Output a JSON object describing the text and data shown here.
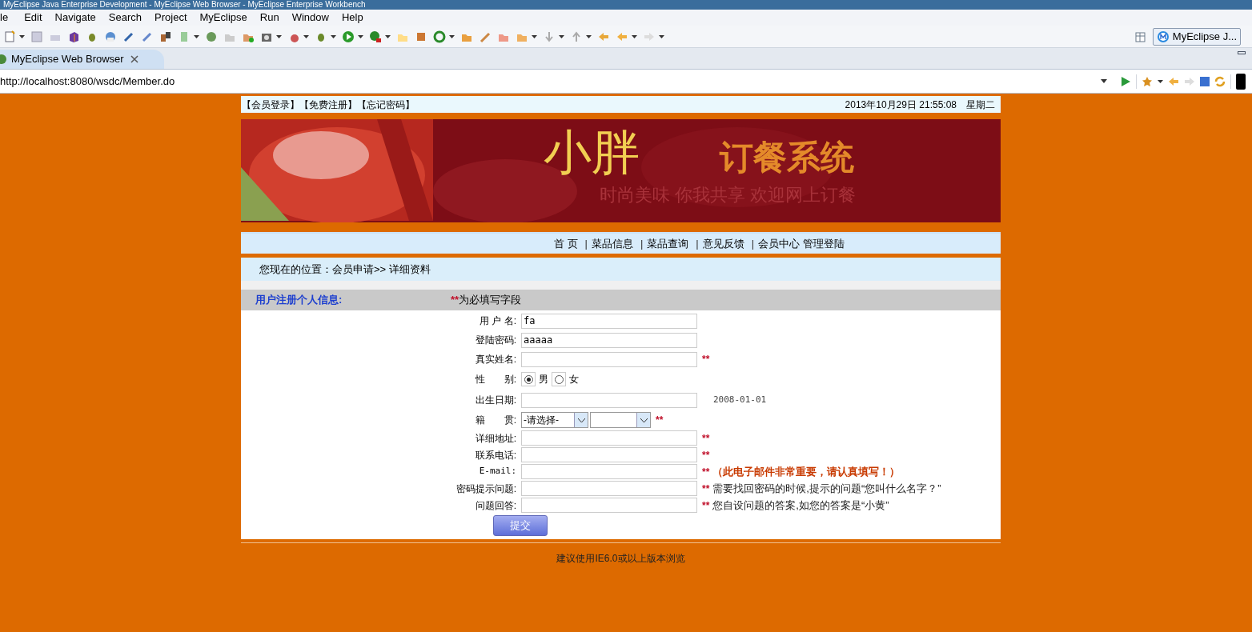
{
  "window": {
    "title": "MyEclipse Java Enterprise Development - MyEclipse Web Browser - MyEclipse Enterprise Workbench"
  },
  "menu": [
    "le",
    "Edit",
    "Navigate",
    "Search",
    "Project",
    "MyEclipse",
    "Run",
    "Window",
    "Help"
  ],
  "perspective": {
    "label": "MyEclipse J..."
  },
  "editor_tab": {
    "label": "MyEclipse Web Browser",
    "selected": true
  },
  "address_bar": {
    "value": "http://localhost:8080/wsdc/Member.do"
  },
  "page": {
    "top_links": [
      "【会员登录】",
      "【免费注册】",
      "【忘记密码】"
    ],
    "datetime": "2013年10月29日 21:55:08",
    "weekday": "星期二",
    "banner": {
      "title": "小胖",
      "subtitle": "订餐系统",
      "slogan": "时尚美味 你我共享 欢迎网上订餐"
    },
    "nav": [
      {
        "kind": "link",
        "label": "首 页"
      },
      {
        "kind": "separator",
        "label": "|"
      },
      {
        "kind": "link",
        "label": "菜品信息"
      },
      {
        "kind": "separator",
        "label": "|"
      },
      {
        "kind": "link",
        "label": "菜品查询"
      },
      {
        "kind": "separator",
        "label": "|"
      },
      {
        "kind": "link",
        "label": "意见反馈"
      },
      {
        "kind": "separator",
        "label": "|"
      },
      {
        "kind": "link",
        "label": "会员中心"
      },
      {
        "kind": "link",
        "label": "管理登陆"
      }
    ],
    "breadcrumb": "您现在的位置：会员申请>> 详细资料",
    "form": {
      "title": "用户注册个人信息:",
      "required_mark": "**",
      "required_note": "为必填写字段",
      "fields": [
        {
          "kind": "text",
          "label": "用 户 名:",
          "value": "fa"
        },
        {
          "kind": "text",
          "label": "登陆密码:",
          "value": "aaaaa"
        },
        {
          "kind": "text",
          "label": "真实姓名:",
          "mark": "**"
        },
        {
          "kind": "radio",
          "label": "性　　别:",
          "options": [
            {
              "label": "男",
              "selected": true
            },
            {
              "label": "女",
              "selected": false
            }
          ]
        },
        {
          "kind": "text",
          "label": "出生日期:",
          "hint": "2008-01-01"
        },
        {
          "kind": "selects",
          "label": "籍　　贯:",
          "selects": [
            {
              "kind": "dropdown",
              "value": "-请选择-"
            },
            {
              "kind": "dropdown"
            }
          ],
          "mark": "**"
        },
        {
          "kind": "text",
          "label": "详细地址:",
          "mark": "**"
        },
        {
          "kind": "text",
          "label": "联系电话:",
          "mark": "**"
        },
        {
          "kind": "text",
          "label": "E-mail:",
          "mono": true,
          "mark": "**",
          "note": "（此电子邮件非常重要，请认真填写！）",
          "color": "#c83a00",
          "note_bold": true
        },
        {
          "kind": "text",
          "label": "密码提示问题:",
          "mark": "**",
          "note": "需要找回密码的时候,提示的问题“您叫什么名字？”",
          "color": "#222222"
        },
        {
          "kind": "text",
          "label": "问题回答:",
          "mark": "**",
          "note": "您自设问题的答案,如您的答案是“小黄”",
          "color": "#222222"
        }
      ],
      "submit": "提交"
    },
    "footer": "建议使用IE6.0或以上版本浏览"
  }
}
